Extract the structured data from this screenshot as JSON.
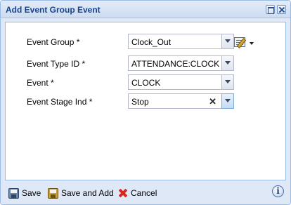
{
  "window": {
    "title": "Add Event Group Event"
  },
  "form": {
    "event_group": {
      "label": "Event Group *",
      "value": "Clock_Out"
    },
    "event_type_id": {
      "label": "Event Type ID *",
      "value": "ATTENDANCE:CLOCK"
    },
    "event": {
      "label": "Event *",
      "value": "CLOCK"
    },
    "event_stage_ind": {
      "label": "Event Stage Ind *",
      "value": "Stop",
      "clear_glyph": "✕"
    }
  },
  "toolbar": {
    "save_label": "Save",
    "save_and_add_label": "Save and Add",
    "cancel_label": "Cancel",
    "info_glyph": "i"
  },
  "icons": {
    "save": "save-icon",
    "save_and_add": "save-add-icon",
    "cancel": "cancel-icon",
    "info": "info-icon",
    "edit_menu": "edit-icon",
    "maximize": "maximize-icon",
    "close": "close-icon"
  },
  "colors": {
    "title_text": "#15428b",
    "panel_bg": "#dfe8f6",
    "border": "#99bbe8",
    "cancel_red": "#d8271c"
  }
}
